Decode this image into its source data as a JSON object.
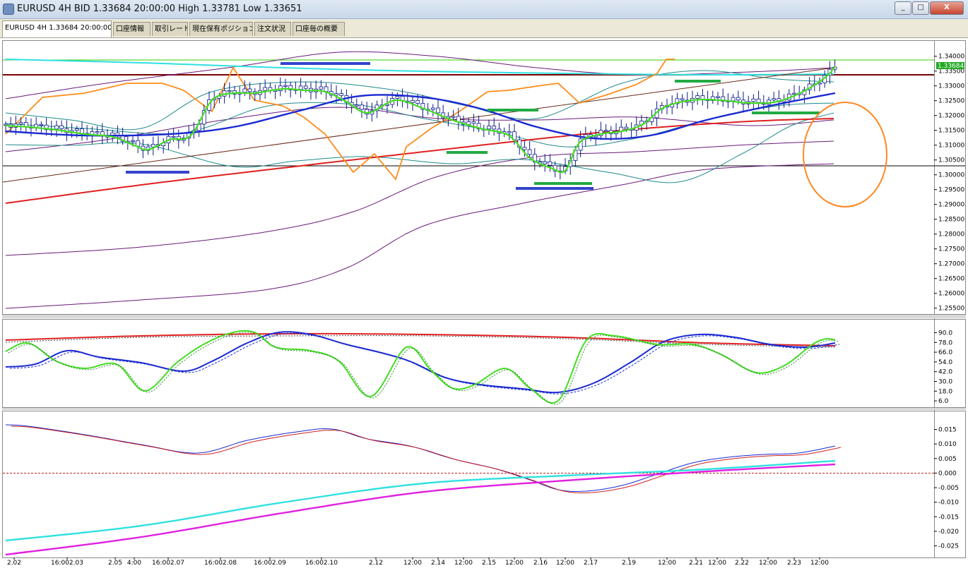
{
  "window": {
    "title": "EURUSD 4H BID 1.33684 20:00:00 High 1.33781 Low 1.33651",
    "btn_min": "_",
    "btn_max": "□",
    "btn_close": "X"
  },
  "tabs": [
    {
      "label": "EURUSD 4H 1.33684 20:00:00"
    },
    {
      "label": "口座情報"
    },
    {
      "label": "取引レート"
    },
    {
      "label": "現在保有ポジション"
    },
    {
      "label": "注文状況"
    },
    {
      "label": "口座毎の概要"
    }
  ],
  "price_panel": {
    "ticks": [
      "1.34000",
      "1.33500",
      "1.33000",
      "1.32500",
      "1.32000",
      "1.31500",
      "1.31000",
      "1.30500",
      "1.30000",
      "1.29500",
      "1.29000",
      "1.28500",
      "1.28000",
      "1.27500",
      "1.27000",
      "1.26500",
      "1.26000",
      "1.25500"
    ],
    "tick_values": [
      1.34,
      1.335,
      1.33,
      1.325,
      1.32,
      1.315,
      1.31,
      1.305,
      1.3,
      1.295,
      1.29,
      1.285,
      1.28,
      1.275,
      1.27,
      1.265,
      1.26,
      1.255
    ],
    "current_price": "1.33684",
    "current_value": 1.33684,
    "range": [
      1.2535,
      1.3435
    ],
    "colors": {
      "bull": "#ffffff",
      "bear": "#ffffff",
      "candle_line": "#0a1a8a",
      "ma_red": "#e02020",
      "ma_blue": "#1a2ad0",
      "ma_green": "#44dd22",
      "bb_purple": "#6a1a7a",
      "bb_teal": "#208a8a",
      "orange": "#ff8c1a",
      "cyan": "#30e0e0",
      "support_green": "#22aa44",
      "support_blue": "#3344cc",
      "hline_dark": "#7a0000",
      "hline_green": "#33cc00",
      "hline_black": "#000000",
      "annotation": "#ff8822"
    }
  },
  "stoch_panel": {
    "ticks": [
      "90.0",
      "78.0",
      "66.0",
      "54.0",
      "42.0",
      "30.0",
      "18.0",
      "6.0"
    ],
    "tick_values": [
      90,
      78,
      66,
      54,
      42,
      30,
      18,
      6
    ],
    "range": [
      0,
      100
    ]
  },
  "macd_panel": {
    "ticks": [
      "0.015",
      "0.010",
      "0.005",
      "0.000",
      "-0.005",
      "-0.010",
      "-0.015",
      "-0.020",
      "-0.025"
    ],
    "tick_values": [
      0.015,
      0.01,
      0.005,
      0,
      -0.005,
      -0.01,
      -0.015,
      -0.02,
      -0.025
    ],
    "range": [
      -0.0285,
      0.0195
    ]
  },
  "time_axis": {
    "labels": [
      "2.02",
      "16:002.03",
      "2.05",
      "4:00",
      "16:002.07",
      "16:002.08",
      "16:002.09",
      "16:002.10",
      "2.12",
      "12:00",
      "2.14",
      "12:00",
      "2.15",
      "12:00",
      "2.16",
      "12:00",
      "2.17",
      "2.19",
      "12:00",
      "2.21",
      "12:00",
      "2.22",
      "12:00",
      "2.23",
      "12:00"
    ],
    "label_x": [
      20,
      95,
      163,
      190,
      238,
      312,
      382,
      455,
      532,
      584,
      620,
      656,
      692,
      728,
      765,
      800,
      836,
      890,
      944,
      985,
      1015,
      1050,
      1087,
      1124,
      1160
    ]
  }
}
